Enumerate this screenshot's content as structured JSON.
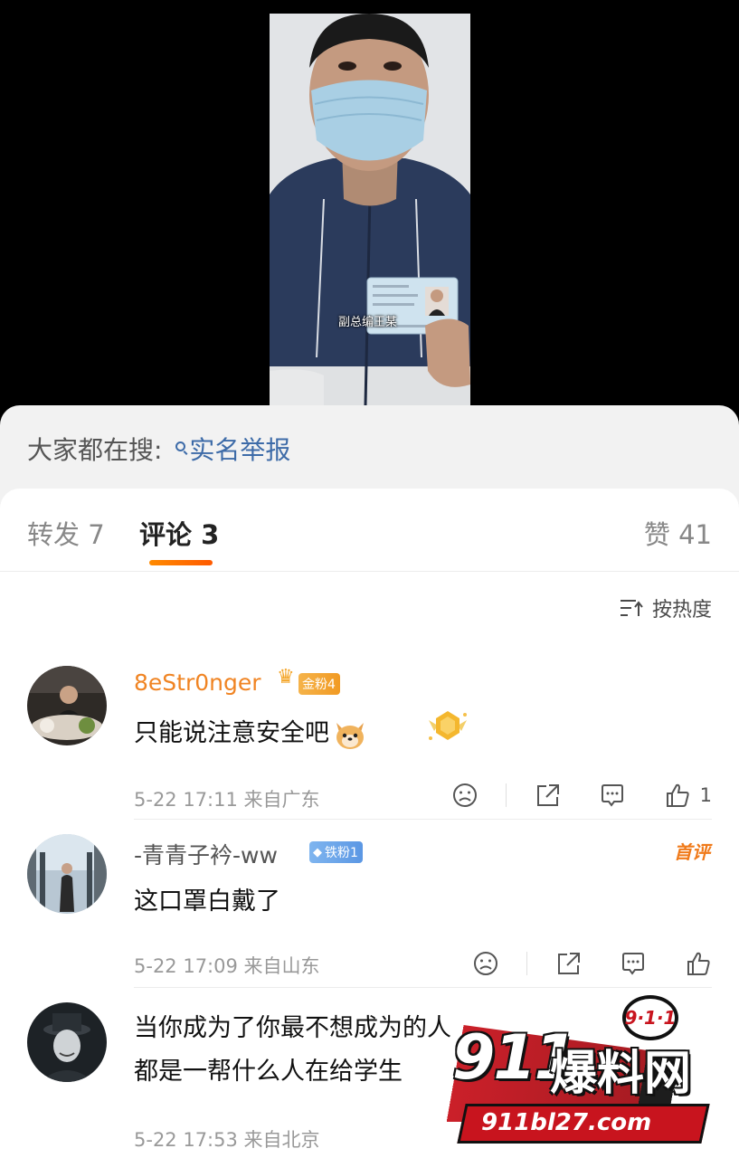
{
  "video": {
    "subtitle": "副总编王某",
    "watermark": "",
    "watermark_sub": ""
  },
  "search_hint": {
    "prefix": "大家都在搜: ",
    "keyword": "实名举报"
  },
  "tabs": {
    "forward": "转发 7",
    "comment": "评论 3",
    "like": "赞 41"
  },
  "sort": {
    "label": "按热度"
  },
  "comments": [
    {
      "username": "8eStr0nger",
      "badge": "金粉4",
      "crown_level": "7",
      "text": "只能说注意安全吧",
      "meta": "5-22 17:11 来自广东",
      "likes": "1"
    },
    {
      "username": "-青青子衿-ww",
      "badge": "铁粉1",
      "first_label": "首评",
      "text": "这口罩白戴了",
      "meta": "5-22 17:09 来自山东",
      "likes": ""
    },
    {
      "username": "",
      "text_line1": "当你成为了你最不想成为的人",
      "text_line2": "都是一帮什么人在给学生",
      "meta": "5-22 17:53 来自北京"
    }
  ],
  "logo": {
    "top": "9·1·1",
    "main_num": "911",
    "main_cn": "爆料网",
    "url": "911bl27.com"
  },
  "colors": {
    "accent_orange": "#f08423",
    "link_blue": "#3d6ba8",
    "tab_indicator": "#ff6a00",
    "logo_red": "#c8141e"
  }
}
